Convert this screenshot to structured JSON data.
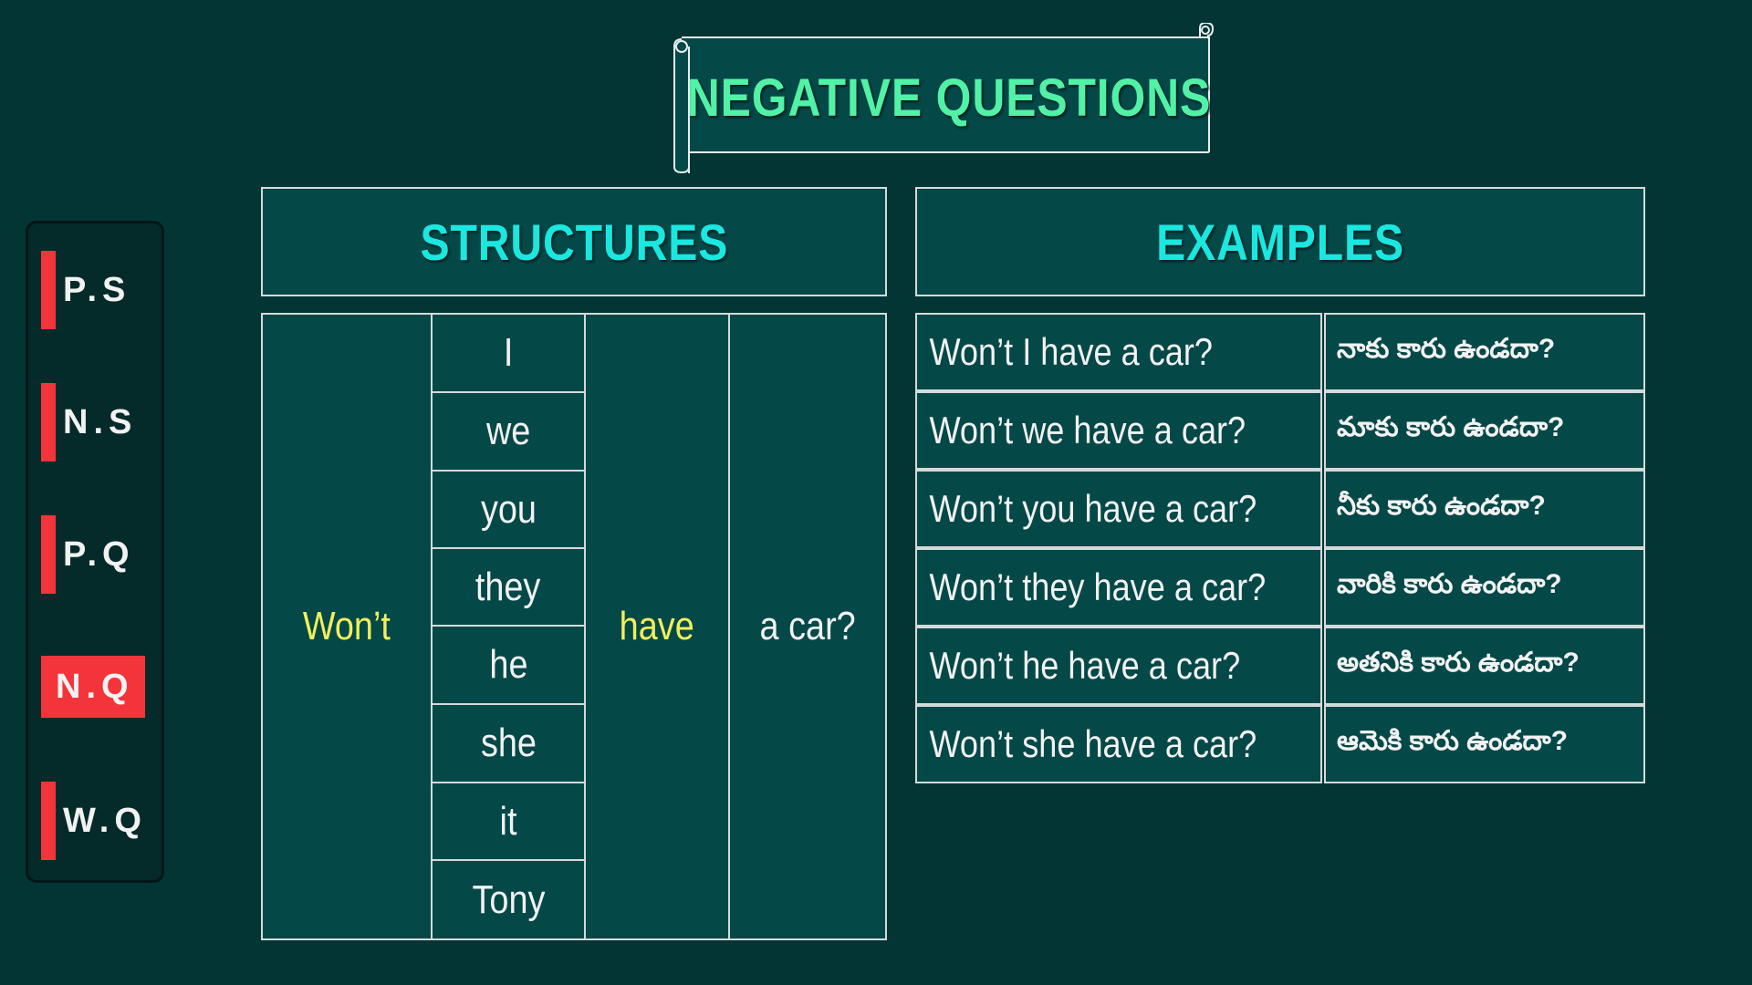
{
  "title": "NEGATIVE QUESTIONS",
  "nav": [
    {
      "label": "P.S",
      "active": false
    },
    {
      "label": "N.S",
      "active": false
    },
    {
      "label": "P.Q",
      "active": false
    },
    {
      "label": "N.Q",
      "active": true
    },
    {
      "label": "W.Q",
      "active": false
    }
  ],
  "structures": {
    "header": "STRUCTURES",
    "aux": "Won’t",
    "subjects": [
      "I",
      "we",
      "you",
      "they",
      "he",
      "she",
      "it",
      "Tony"
    ],
    "verb": "have",
    "object": "a car?"
  },
  "examples": {
    "header": "EXAMPLES",
    "rows": [
      {
        "en": "Won’t I have a car?",
        "te": "నాకు కారు ఉండదా?"
      },
      {
        "en": "Won’t we have a car?",
        "te": "మాకు కారు ఉండదా?"
      },
      {
        "en": "Won’t you have a car?",
        "te": "నీకు కారు ఉండదా?"
      },
      {
        "en": "Won’t they have a car?",
        "te": "వారికి కారు ఉండదా?"
      },
      {
        "en": "Won’t he have a car?",
        "te": "అతనికి కారు ఉండదా?"
      },
      {
        "en": "Won’t she have a car?",
        "te": "ఆమెకి కారు ఉండదా?"
      }
    ]
  },
  "colors": {
    "background": "#033535",
    "panel": "#054848",
    "title": "#52f2a6",
    "header": "#1ae8e0",
    "highlight": "#f0f05a",
    "nav_accent": "#f3353b"
  }
}
